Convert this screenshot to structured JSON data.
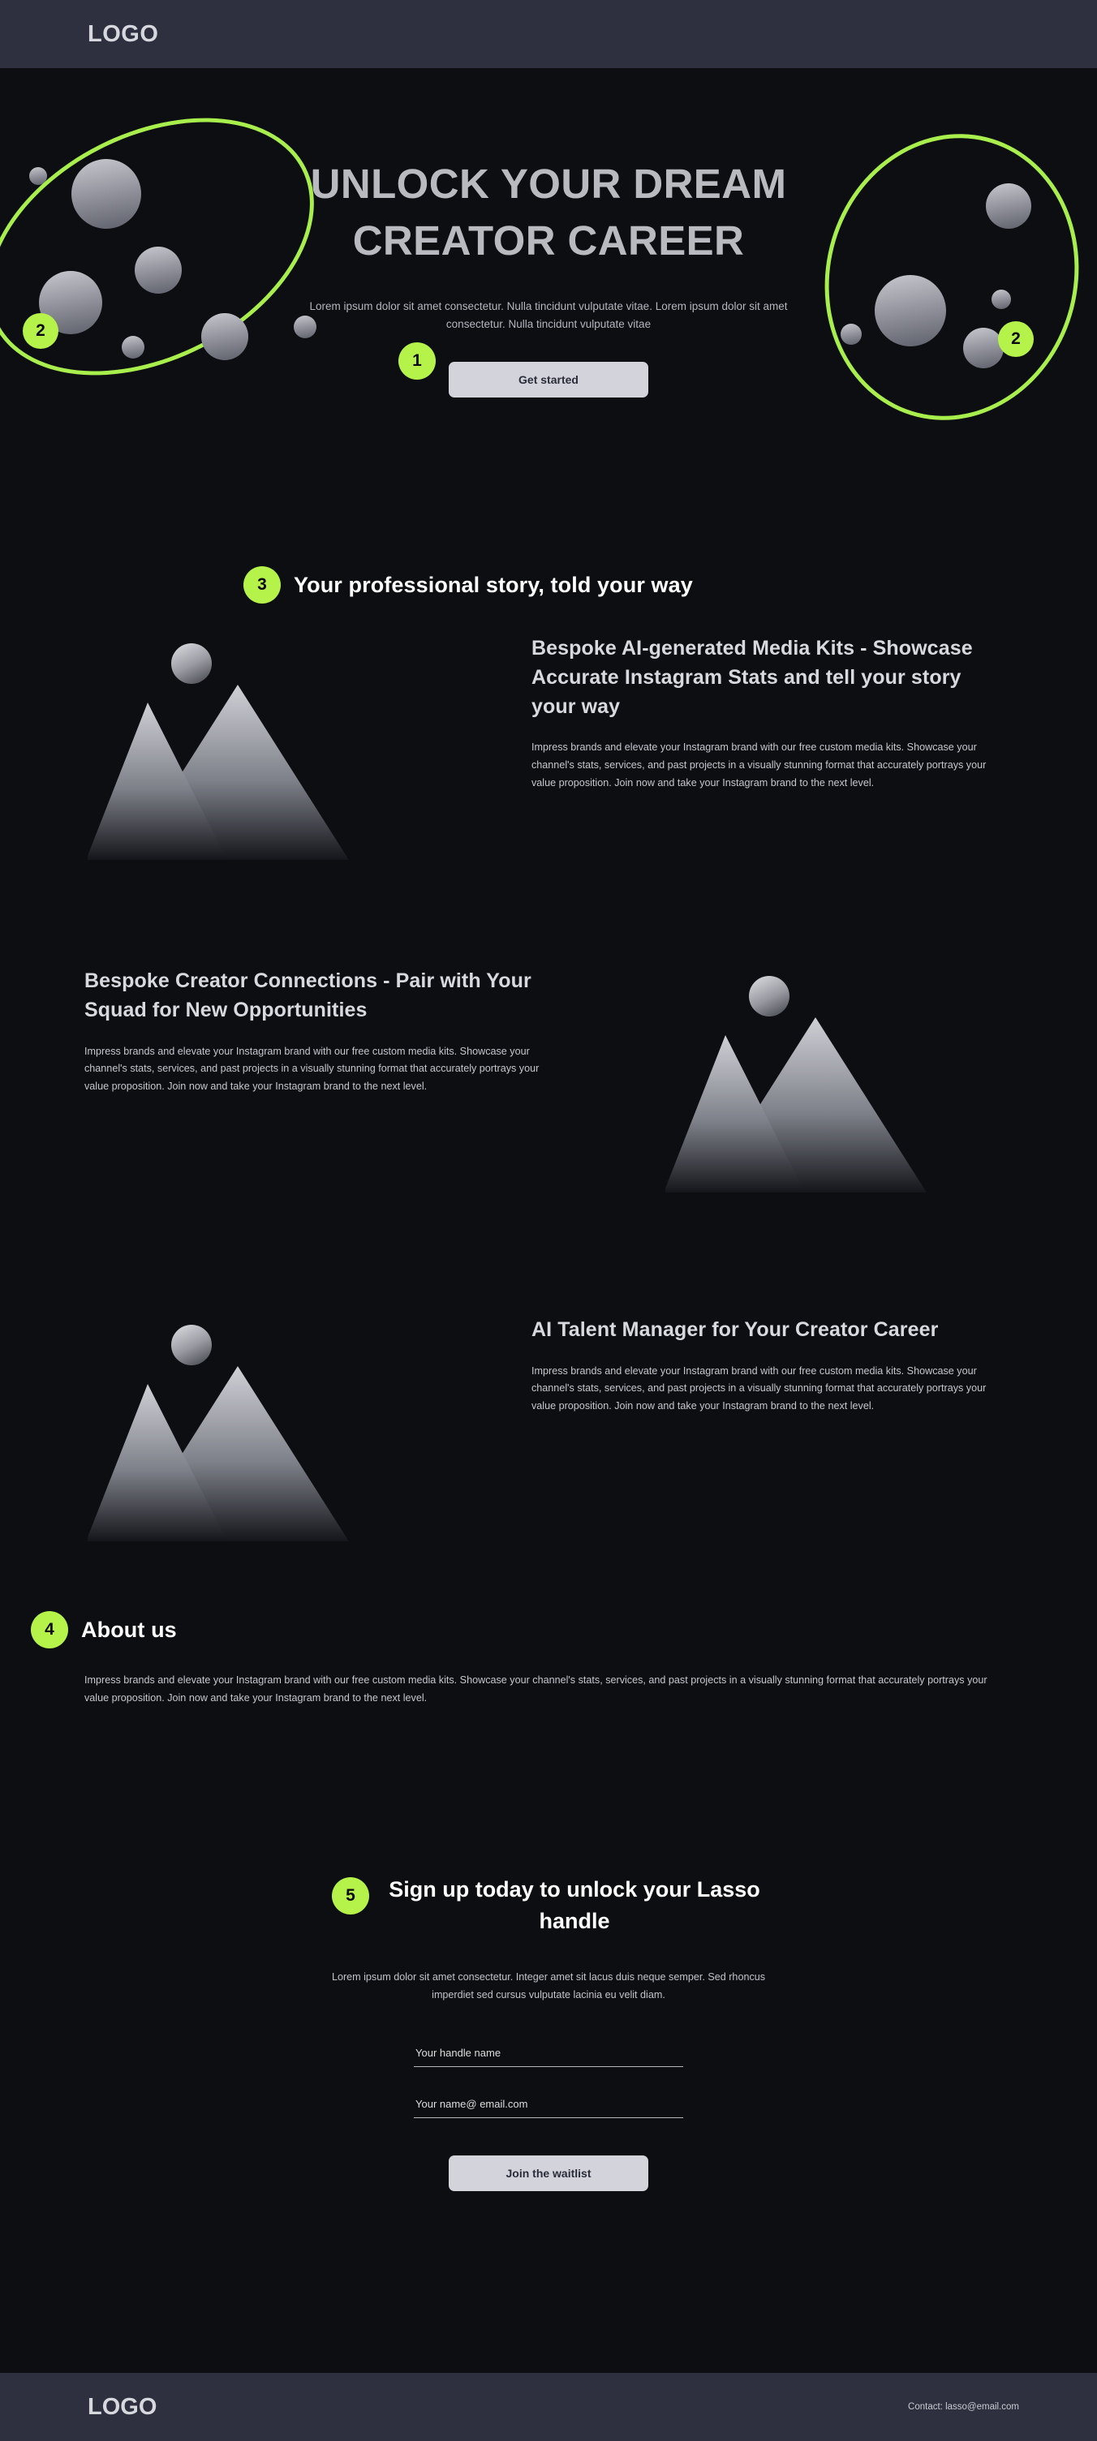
{
  "header": {
    "logo": "LOGO"
  },
  "hero": {
    "title_line1": "UNLOCK YOUR DREAM",
    "title_line2": "CREATOR CAREER",
    "subtitle": "Lorem ipsum dolor sit amet consectetur. Nulla tincidunt vulputate vitae. Lorem ipsum dolor sit amet consectetur. Nulla tincidunt vulputate vitae",
    "cta_label": "Get started",
    "badge_cta": "1",
    "badge_left_ring": "2",
    "badge_right_ring": "2"
  },
  "story_section": {
    "badge": "3",
    "heading": "Your professional story, told your way"
  },
  "features": [
    {
      "heading": "Bespoke AI-generated Media Kits - Showcase Accurate Instagram Stats and tell your story your way",
      "body": "Impress brands and elevate your Instagram brand with our free custom media kits. Showcase your channel's stats, services, and past projects in a visually stunning format that accurately portrays your value proposition. Join now and take your Instagram brand to the next level.",
      "media_alt": "mountain-placeholder"
    },
    {
      "heading": "Bespoke Creator Connections - Pair with Your Squad for New Opportunities",
      "body": "Impress brands and elevate your Instagram brand with our free custom media kits. Showcase your channel's stats, services, and past projects in a visually stunning format that accurately portrays your value proposition. Join now and take your Instagram brand to the next level.",
      "media_alt": "mountain-placeholder"
    },
    {
      "heading": "AI Talent Manager for Your Creator Career",
      "body": "Impress brands and elevate your Instagram brand with our free custom media kits. Showcase your channel's stats, services, and past projects in a visually stunning format that accurately portrays your value proposition. Join now and take your Instagram brand to the next level.",
      "media_alt": "mountain-placeholder"
    }
  ],
  "about": {
    "badge": "4",
    "heading": "About us",
    "body": "Impress brands and elevate your Instagram brand with our free custom media kits. Showcase your channel's stats, services, and past projects in a visually stunning format that accurately portrays your value proposition. Join now and take your Instagram brand to the next level."
  },
  "signup": {
    "badge": "5",
    "heading": "Sign up today to unlock your Lasso handle",
    "lead": "Lorem ipsum dolor sit amet consectetur. Integer amet sit lacus duis neque semper. Sed rhoncus imperdiet sed cursus vulputate lacinia eu velit diam.",
    "handle_placeholder": "Your handle name",
    "email_placeholder": "Your name@ email.com",
    "submit_label": "Join the waitlist"
  },
  "footer": {
    "logo": "LOGO",
    "contact": "Contact: lasso@email.com"
  },
  "colors": {
    "accent_lime": "#b5f24a",
    "bar_slate": "#2e3040",
    "page_bg": "#0d0e12",
    "button_light": "#d3d4db"
  }
}
